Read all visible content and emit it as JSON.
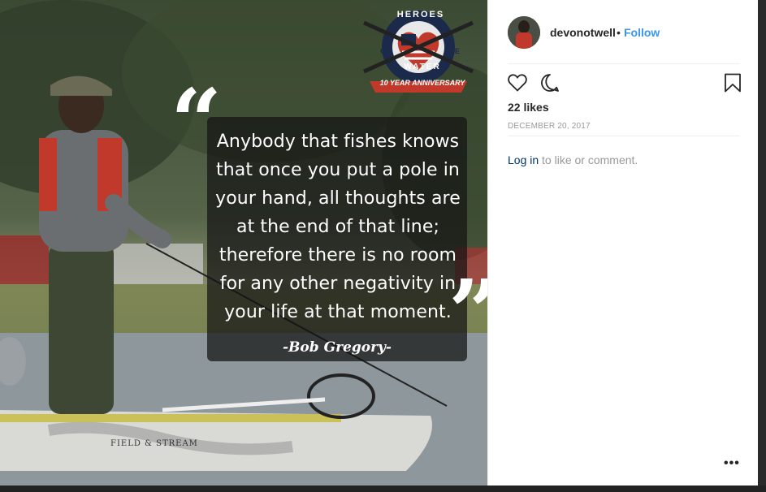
{
  "post": {
    "quote_lines": "Anybody that fishes knows\nthat once you put a pole in\nyour hand, all thoughts are\nat the end of that line;\ntherefore there is no room\nfor any other negativity in\nyour life at that moment.",
    "quote_author": "-Bob Gregory-",
    "logo": {
      "heroes": "HEROES",
      "on": "ON",
      "the": "THE",
      "water": "WATER",
      "anniversary": "10 YEAR ANNIVERSARY"
    },
    "boat_brand": "FIELD & STREAM"
  },
  "header": {
    "username": "devonotwell",
    "separator": "•",
    "follow_label": "Follow"
  },
  "actions": {
    "like_icon": "heart-icon",
    "comment_icon": "comment-icon",
    "save_icon": "bookmark-icon"
  },
  "stats": {
    "likes": "22 likes",
    "date": "DECEMBER 20, 2017"
  },
  "comment_prompt": {
    "login_label": "Log in",
    "rest_text": " to like or comment."
  },
  "more_label": "•••",
  "colors": {
    "link_blue": "#3897f0",
    "login_blue": "#003569",
    "text_dark": "#262626",
    "muted": "#999999"
  }
}
